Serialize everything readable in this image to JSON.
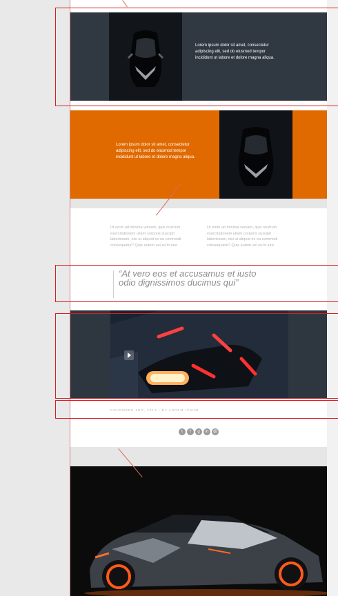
{
  "top_block": {
    "text": "Lorem ipsum dolor sit amet, consectetur adipiscing elit, sed do eiusmod tempor incididunt ut labore et dolore magna aliqua."
  },
  "orange_block": {
    "text": "Lorem ipsum dolor sit amet, consectetur adipiscing elit, sed do eiusmod tempor incididunt ut labore et dolore magna aliqua."
  },
  "columns": [
    {
      "text": "Ut enim ad minima veniam, quis nostrum exercitationem ullam corporis suscipit laboriosam, nisi ut aliquid ex ea commodi consequatur? Quis autem vel eu'm iure"
    },
    {
      "text": "Ut enim ad minima veniam, quis nostrum exercitationem ullam corporis suscipit laboriosam, nisi ut aliquid ex ea commodi consequatur? Quis autem vel eu'm iure"
    }
  ],
  "quote": {
    "text": "“At vero eos et accusamus et iusto odio dignissimos ducimus qui”"
  },
  "post_meta": {
    "text": "NOVEMBER 3RD, 2013 • BY LOREM IPSUM"
  },
  "social": {
    "icons": [
      "twitter-icon",
      "facebook-icon",
      "google-plus-icon",
      "linkedin-icon",
      "email-icon"
    ],
    "glyphs": [
      "t",
      "f",
      "g",
      "in",
      "@"
    ]
  },
  "colors": {
    "dark_block": "#303841",
    "accent_orange": "#e06a00",
    "annotation_red": "#d62020"
  }
}
